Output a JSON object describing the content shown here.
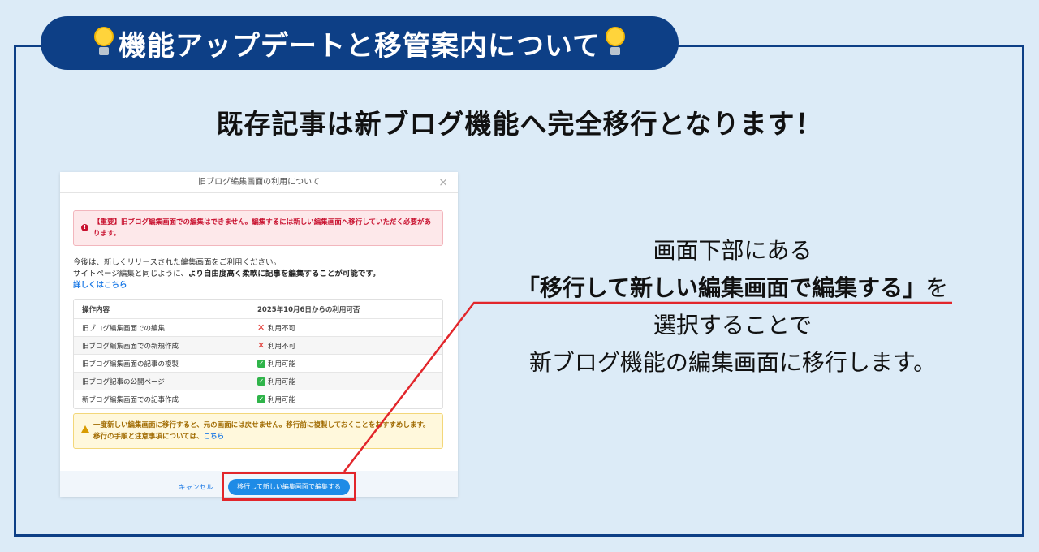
{
  "banner": {
    "title": "機能アップデートと移管案内について",
    "icon": "lightbulb-icon"
  },
  "headline": "既存記事は新ブログ機能へ完全移行となります！",
  "modal": {
    "title": "旧ブログ編集画面の利用について",
    "close": "×",
    "alert_red": "【重要】旧ブログ編集画面での編集はできません。編集するには新しい編集画面へ移行していただく必要があります。",
    "intro_line1": "今後は、新しくリリースされた編集画面をご利用ください。",
    "intro_line2_a": "サイトページ編集と同じように、",
    "intro_line2_b": "より自由度高く柔軟に記事を編集することが可能です。",
    "intro_link": "詳しくはこちら",
    "table": {
      "headers": [
        "操作内容",
        "2025年10月6日からの利用可否"
      ],
      "rows": [
        {
          "op": "旧ブログ編集画面での編集",
          "status": "利用不可",
          "ok": false
        },
        {
          "op": "旧ブログ編集画面での新規作成",
          "status": "利用不可",
          "ok": false
        },
        {
          "op": "旧ブログ編集画面の記事の複製",
          "status": "利用可能",
          "ok": true
        },
        {
          "op": "旧ブログ記事の公開ページ",
          "status": "利用可能",
          "ok": true
        },
        {
          "op": "新ブログ編集画面での記事作成",
          "status": "利用可能",
          "ok": true
        }
      ]
    },
    "alert_yellow_line1": "一度新しい編集画面に移行すると、元の画面には戻せません。移行前に複製しておくことをおすすめします。",
    "alert_yellow_line2": "移行の手順と注意事項については、",
    "alert_yellow_link": "こちら",
    "cancel": "キャンセル",
    "migrate": "移行して新しい編集画面で編集する"
  },
  "side": {
    "line1": "画面下部にある",
    "line2_em": "「移行して新しい編集画面で編集する」",
    "line2_tail": "を",
    "line3": "選択することで",
    "line4": "新ブログ機能の編集画面に移行します。"
  },
  "colors": {
    "navy": "#0d3f86",
    "red": "#e2262b",
    "blue": "#1e8be6"
  }
}
